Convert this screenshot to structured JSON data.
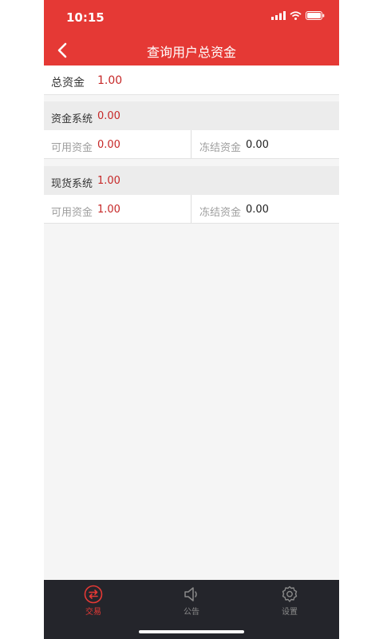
{
  "status": {
    "time": "10:15"
  },
  "header": {
    "title": "查询用户总资金"
  },
  "total": {
    "label": "总资金",
    "value": "1.00"
  },
  "sections": [
    {
      "title": "资金系统",
      "amount": "0.00",
      "available_label": "可用资金",
      "available_value": "0.00",
      "frozen_label": "冻结资金",
      "frozen_value": "0.00"
    },
    {
      "title": "现货系统",
      "amount": "1.00",
      "available_label": "可用资金",
      "available_value": "1.00",
      "frozen_label": "冻结资金",
      "frozen_value": "0.00"
    }
  ],
  "tabbar": {
    "items": [
      {
        "label": "交易",
        "icon": "exchange-icon",
        "active": true
      },
      {
        "label": "公告",
        "icon": "speaker-icon",
        "active": false
      },
      {
        "label": "设置",
        "icon": "gear-icon",
        "active": false
      }
    ]
  },
  "colors": {
    "primary": "#e53935",
    "value_red": "#c62828",
    "tab_active": "#e53935",
    "tab_inactive": "#8a8a8a",
    "tabbar_bg": "#24252b"
  }
}
